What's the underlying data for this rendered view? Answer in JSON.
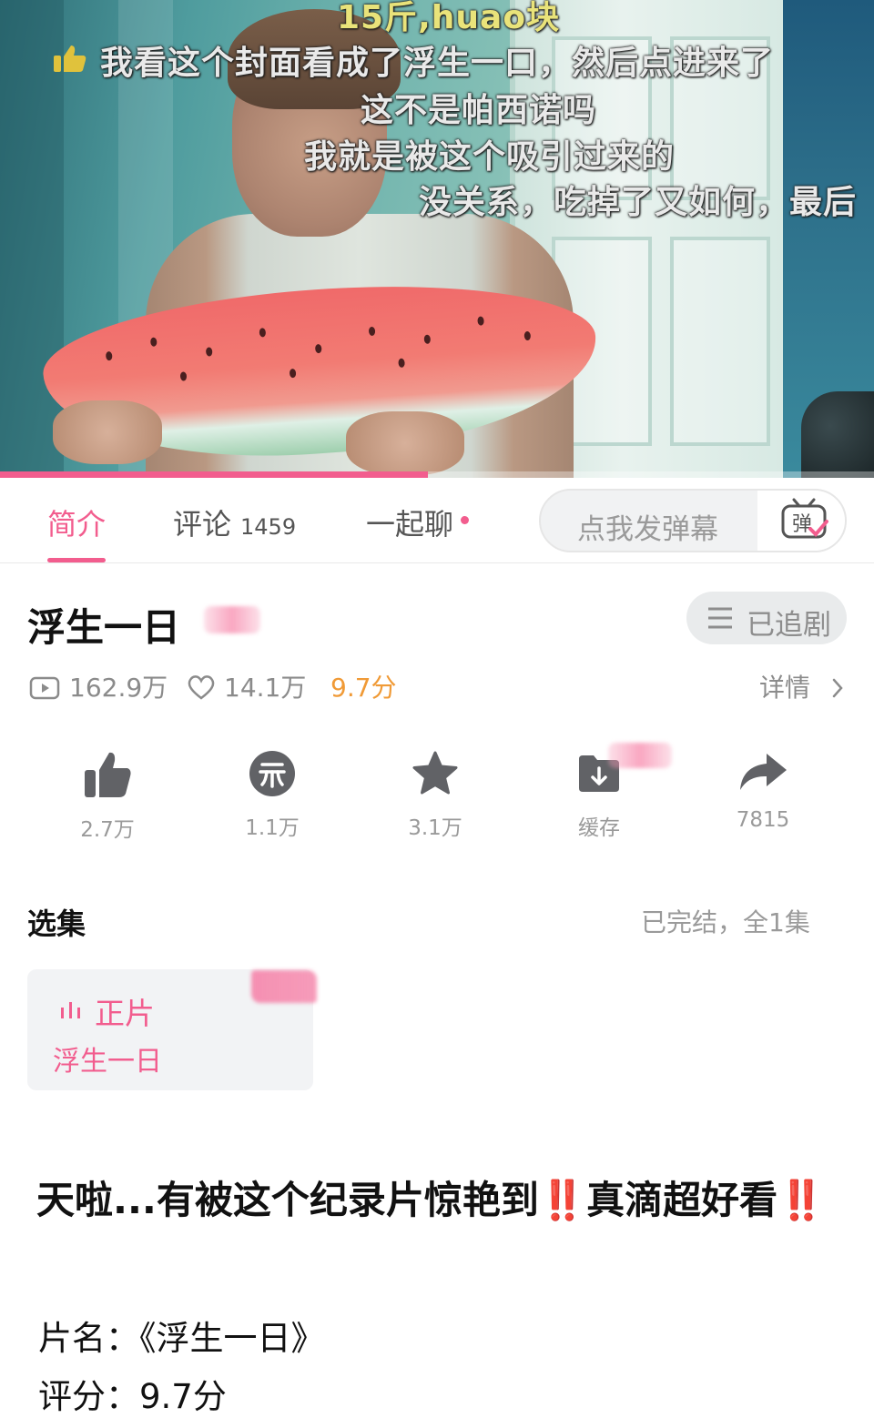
{
  "video": {
    "danmaku": [
      {
        "text": "15斤,huao块"
      },
      {
        "text": "我看这个封面看成了浮生一口，然后点进来了"
      },
      {
        "text": "这不是帕西诺吗"
      },
      {
        "text": "我就是被这个吸引过来的"
      },
      {
        "text": "没关系，吃掉了又如何，最后"
      }
    ],
    "progress": 0.49
  },
  "tabs": {
    "intro": "简介",
    "comments": "评论",
    "comment_count": "1459",
    "chat": "一起聊",
    "danmaku_placeholder": "点我发弹幕",
    "danmaku_icon": "弹"
  },
  "info": {
    "title": "浮生一日",
    "follow_label": "已追剧",
    "views": "162.9万",
    "likes_stat": "14.1万",
    "score": "9.7分",
    "detail": "详情"
  },
  "actions": [
    {
      "label": "2.7万",
      "icon": "thumb-up-icon"
    },
    {
      "label": "1.1万",
      "icon": "coin-icon"
    },
    {
      "label": "3.1万",
      "icon": "star-icon"
    },
    {
      "label": "缓存",
      "icon": "download-icon"
    },
    {
      "label": "7815",
      "icon": "share-icon"
    }
  ],
  "episodes": {
    "section_title": "选集",
    "meta": "已完结，全1集",
    "card_label": "正片",
    "card_title": "浮生一日"
  },
  "post": {
    "headline_part1": "天啦...有被这个纪录片惊艳到",
    "bang": "‼️",
    "headline_part2": "真滴超好看",
    "line1": "片名：《浮生一日》",
    "line2": "评分：9.7分"
  },
  "colors": {
    "accent": "#f25d8e",
    "score": "#f09a36",
    "exclaim": "#e5262a"
  }
}
